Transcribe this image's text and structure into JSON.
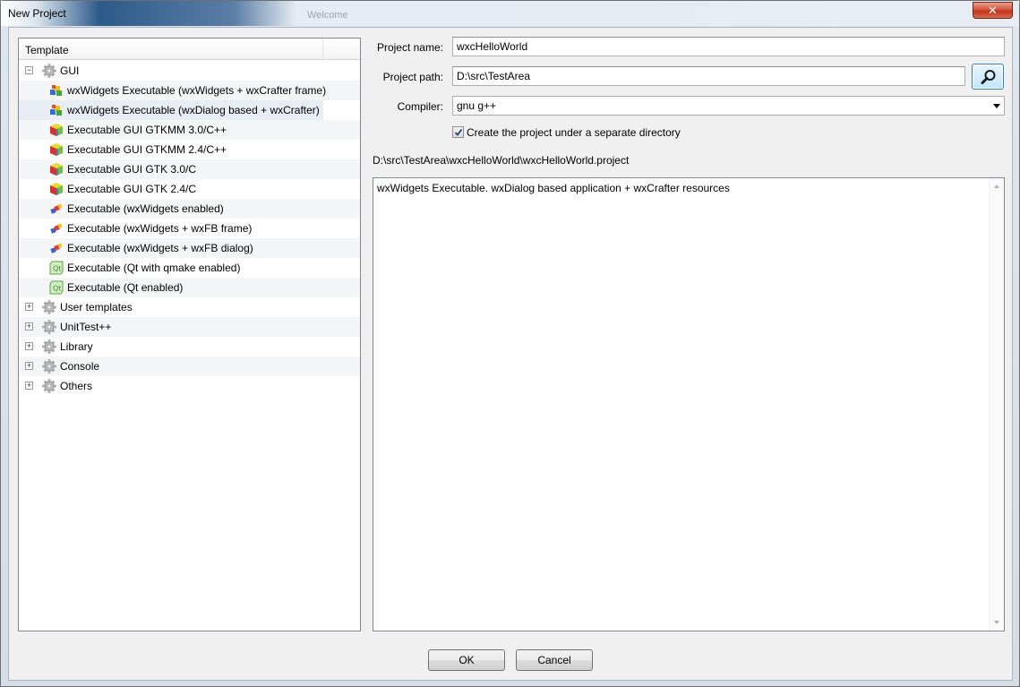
{
  "window": {
    "title": "New Project",
    "ghost_tab": "Welcome",
    "close_label": "✕"
  },
  "tree": {
    "header": "Template",
    "items": [
      {
        "label": "GUI",
        "level": 0,
        "expander": "−",
        "icon": "gear-icon"
      },
      {
        "label": "wxWidgets Executable (wxWidgets + wxCrafter frame)",
        "level": 1,
        "icon": "wxcrafter-icon"
      },
      {
        "label": "wxWidgets Executable (wxDialog based + wxCrafter)",
        "level": 1,
        "icon": "wxcrafter-icon",
        "selected": true
      },
      {
        "label": "Executable GUI GTKMM 3.0/C++",
        "level": 1,
        "icon": "gtk-cube-icon"
      },
      {
        "label": "Executable GUI GTKMM 2.4/C++",
        "level": 1,
        "icon": "gtk-cube-icon"
      },
      {
        "label": "Executable GUI GTK 3.0/C",
        "level": 1,
        "icon": "gtk-cube-icon"
      },
      {
        "label": "Executable GUI GTK 2.4/C",
        "level": 1,
        "icon": "gtk-cube-icon"
      },
      {
        "label": "Executable (wxWidgets enabled)",
        "level": 1,
        "icon": "wxwidgets-icon"
      },
      {
        "label": "Executable (wxWidgets + wxFB frame)",
        "level": 1,
        "icon": "wxwidgets-icon"
      },
      {
        "label": "Executable (wxWidgets + wxFB dialog)",
        "level": 1,
        "icon": "wxwidgets-icon"
      },
      {
        "label": "Executable (Qt with qmake enabled)",
        "level": 1,
        "icon": "qt-icon"
      },
      {
        "label": "Executable (Qt enabled)",
        "level": 1,
        "icon": "qt-icon"
      },
      {
        "label": "User templates",
        "level": 0,
        "expander": "+",
        "icon": "gear-icon"
      },
      {
        "label": "UnitTest++",
        "level": 0,
        "expander": "+",
        "icon": "gear-icon"
      },
      {
        "label": "Library",
        "level": 0,
        "expander": "+",
        "icon": "gear-icon"
      },
      {
        "label": "Console",
        "level": 0,
        "expander": "+",
        "icon": "gear-icon"
      },
      {
        "label": "Others",
        "level": 0,
        "expander": "+",
        "icon": "gear-icon"
      }
    ]
  },
  "form": {
    "project_name_label": "Project name:",
    "project_name_value": "wxcHelloWorld",
    "project_path_label": "Project path:",
    "project_path_value": "D:\\src\\TestArea",
    "compiler_label": "Compiler:",
    "compiler_value": "gnu g++",
    "separate_dir_label": "Create the project under a separate directory",
    "separate_dir_checked": true,
    "full_path": "D:\\src\\TestArea\\wxcHelloWorld\\wxcHelloWorld.project",
    "description": "wxWidgets Executable. wxDialog based application + wxCrafter resources"
  },
  "buttons": {
    "ok": "OK",
    "cancel": "Cancel"
  }
}
